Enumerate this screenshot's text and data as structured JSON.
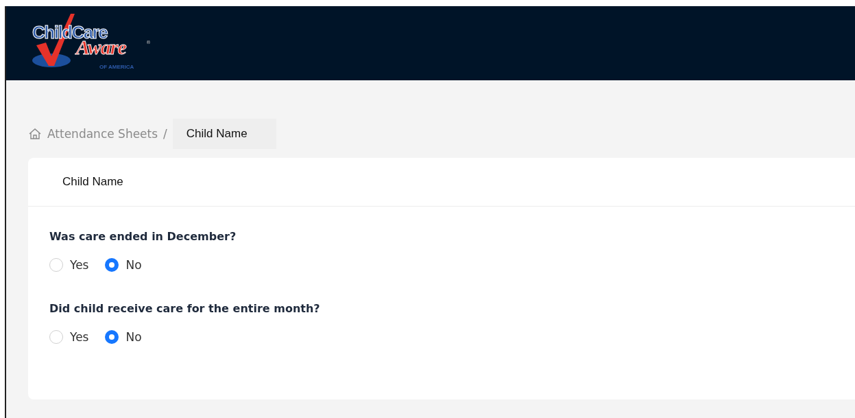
{
  "header": {
    "logo": {
      "line1": "ChildCare",
      "line2": "Aware",
      "reg": "®",
      "line3": "OF AMERICA"
    }
  },
  "breadcrumb": [
    {
      "label": "Attendance Sheets",
      "selected": false
    },
    {
      "label": "Child Name",
      "selected": true
    }
  ],
  "breadcrumb_separator": "/",
  "card": {
    "title": "Child Name",
    "questions": [
      {
        "text": "Was care ended in December?",
        "options": [
          {
            "label": "Yes",
            "selected": false
          },
          {
            "label": "No",
            "selected": true
          }
        ]
      },
      {
        "text": "Did child receive care for the entire month?",
        "options": [
          {
            "label": "Yes",
            "selected": false
          },
          {
            "label": "No",
            "selected": true
          }
        ]
      }
    ]
  }
}
